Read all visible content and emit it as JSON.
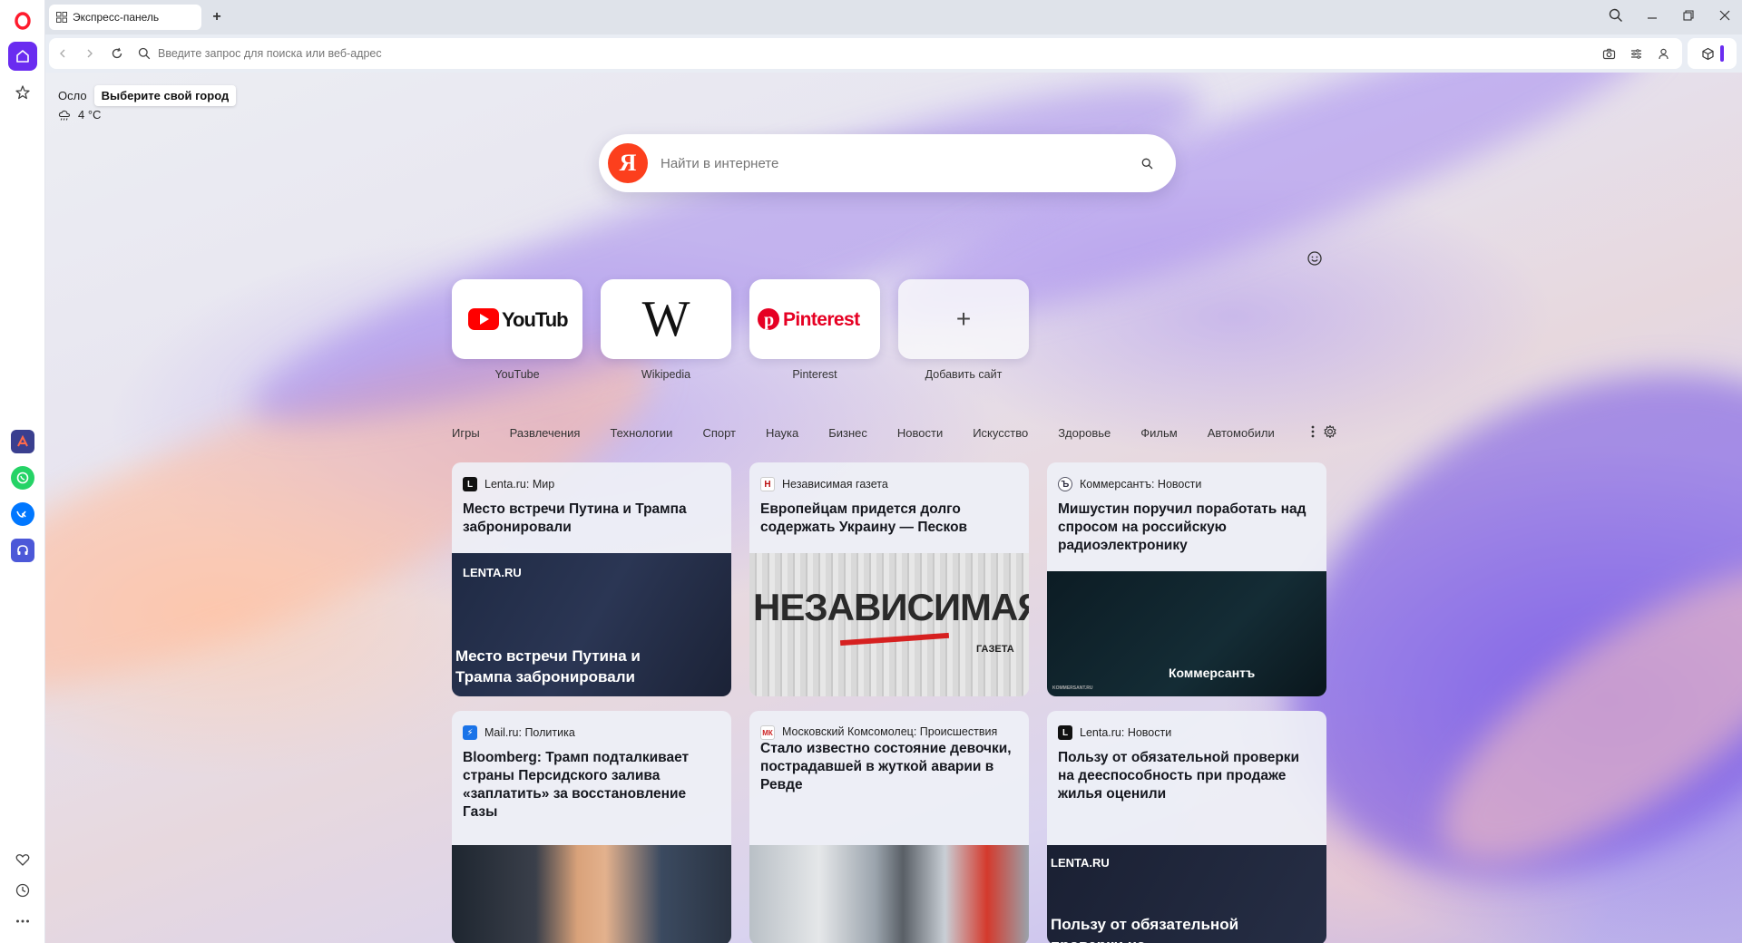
{
  "browser": {
    "tab_title": "Экспресс-панель",
    "address_placeholder": "Введите запрос для поиска или веб-адрес"
  },
  "weather": {
    "city": "Осло",
    "city_tooltip": "Выберите свой город",
    "temperature": "4 °C"
  },
  "search": {
    "placeholder": "Найти в интернете",
    "logo_letter": "Я"
  },
  "speed_dials": [
    {
      "label": "YouTube",
      "logo_text": "YouTube"
    },
    {
      "label": "Wikipedia",
      "logo_text": "W"
    },
    {
      "label": "Pinterest",
      "logo_text": "Pinterest"
    },
    {
      "label": "Добавить сайт",
      "logo_text": "+"
    }
  ],
  "categories": [
    "Игры",
    "Развлечения",
    "Технологии",
    "Спорт",
    "Наука",
    "Бизнес",
    "Новости",
    "Искусство",
    "Здоровье",
    "Фильм",
    "Автомобили"
  ],
  "news": [
    {
      "source": "Lenta.ru: Мир",
      "title": "Место встречи Путина и Трампа забронировали",
      "image_brand": "LENTA.RU",
      "image_caption": "Место встречи Путина и Трампа забронировали"
    },
    {
      "source": "Независимая газета",
      "title": "Европейцам придется долго содержать Украину — Песков",
      "image_brand": "НЕЗАВИСИМАЯ",
      "image_caption": "ГАЗЕТА"
    },
    {
      "source": "Коммерсантъ: Новости",
      "title": "Мишустин поручил поработать над спросом на российскую радиоэлектронику",
      "image_brand": "Коммерсантъ",
      "image_caption": "KOMMERSANT.RU"
    },
    {
      "source": "Mail.ru: Политика",
      "title": "Bloomberg: Трамп подталкивает страны Персидского залива «заплатить» за восстановление Газы"
    },
    {
      "source": "Московский Комсомолец: Происшествия",
      "title": "Стало известно состояние девочки, пострадавшей в жуткой аварии в Ревде"
    },
    {
      "source": "Lenta.ru: Новости",
      "title": "Пользу от обязательной проверки на дееспособность при продаже жилья оценили",
      "image_brand": "LENTA.RU",
      "image_caption": "Пользу от обязательной проверки на дееспособность"
    }
  ],
  "colors": {
    "accent": "#6a2cf0",
    "opera_red": "#ff1b2d",
    "yandex_red": "#fc3f1d",
    "youtube_red": "#ff0000",
    "pinterest_red": "#e60023"
  }
}
